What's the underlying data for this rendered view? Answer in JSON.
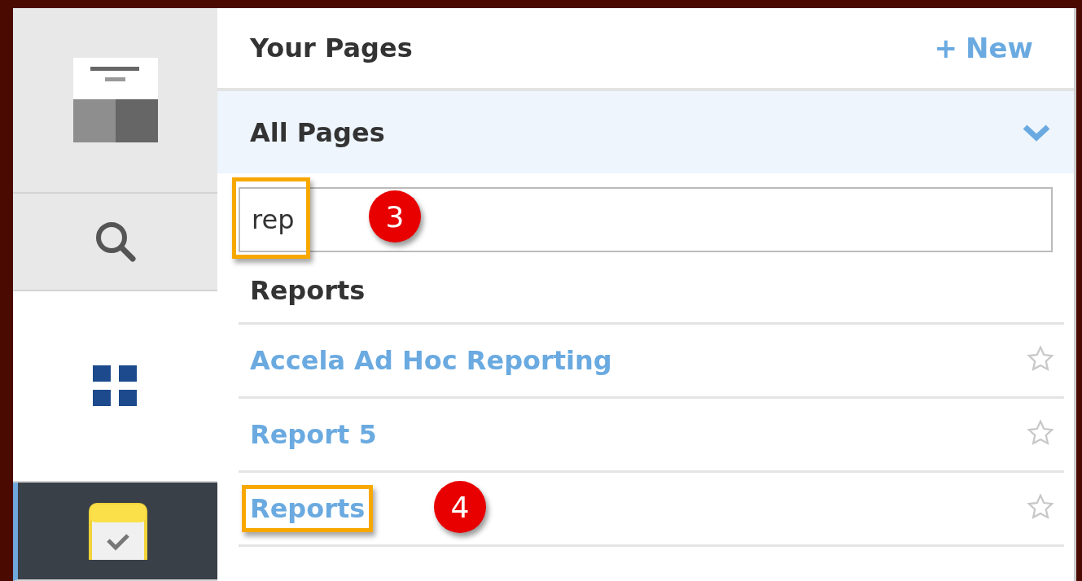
{
  "sidebar": {
    "items": [
      {
        "kind": "layout",
        "selected": false
      },
      {
        "kind": "search",
        "selected": false
      },
      {
        "kind": "apps",
        "selected": false
      },
      {
        "kind": "tasks",
        "selected": true
      }
    ]
  },
  "header": {
    "title": "Your Pages",
    "new_button": {
      "icon": "+",
      "label": "New"
    }
  },
  "section": {
    "title": "All Pages",
    "expanded": true
  },
  "search": {
    "value": "rep",
    "callout": "3"
  },
  "results": {
    "heading": "Reports",
    "items": [
      {
        "label": "Accela Ad Hoc Reporting",
        "starred": false
      },
      {
        "label": "Report 5",
        "starred": false
      },
      {
        "label": "Reports",
        "starred": false,
        "callout": "4"
      }
    ]
  }
}
